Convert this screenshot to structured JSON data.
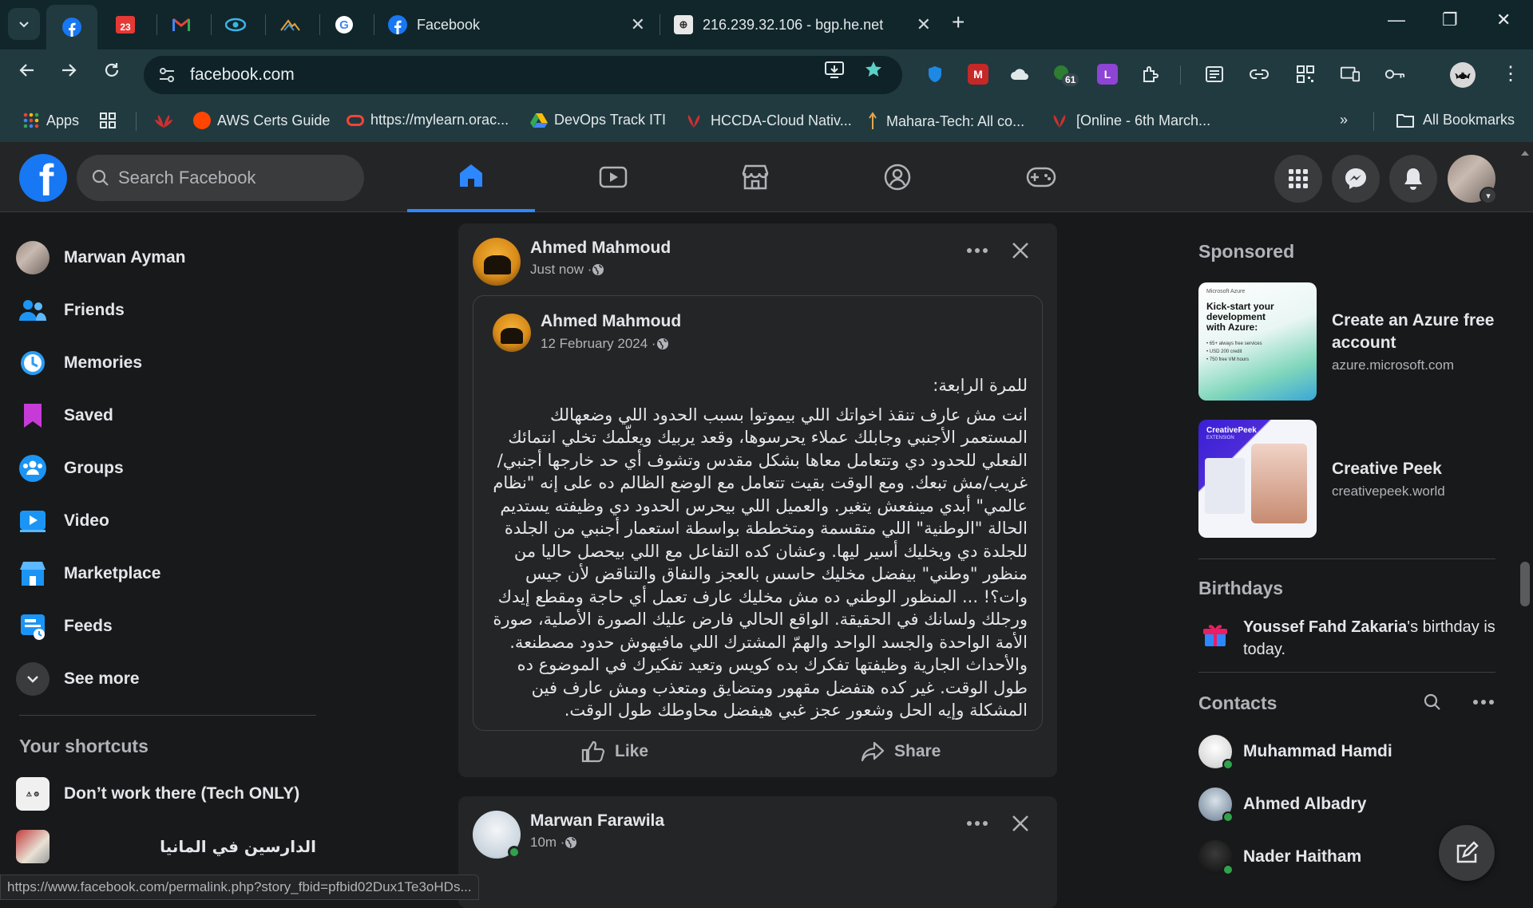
{
  "browser": {
    "tabs": [
      {
        "title": "Facebook"
      },
      {
        "title": "216.239.32.106 - bgp.he.net"
      }
    ],
    "pinned_badge": "23",
    "address_url": "facebook.com",
    "extension_badge": "61",
    "extension_letter": "L",
    "bookmarks": [
      {
        "label": "Apps"
      },
      {
        "label": "AWS Certs Guide"
      },
      {
        "label": "https://mylearn.orac..."
      },
      {
        "label": "DevOps Track ITI"
      },
      {
        "label": "HCCDA-Cloud Nativ..."
      },
      {
        "label": "Mahara-Tech: All co..."
      },
      {
        "label": "[Online - 6th March..."
      }
    ],
    "all_bookmarks": "All Bookmarks",
    "status_url": "https://www.facebook.com/permalink.php?story_fbid=pfbid02Dux1Te3oHDs..."
  },
  "fb": {
    "search_placeholder": "Search Facebook",
    "left_menu": [
      {
        "label": "Marwan Ayman",
        "icon": "profile-avatar"
      },
      {
        "label": "Friends",
        "icon": "friends-icon"
      },
      {
        "label": "Memories",
        "icon": "memories-icon"
      },
      {
        "label": "Saved",
        "icon": "saved-icon"
      },
      {
        "label": "Groups",
        "icon": "groups-icon"
      },
      {
        "label": "Video",
        "icon": "video-icon"
      },
      {
        "label": "Marketplace",
        "icon": "marketplace-icon"
      },
      {
        "label": "Feeds",
        "icon": "feeds-icon"
      },
      {
        "label": "See more",
        "icon": "chevron-down-icon"
      }
    ],
    "shortcuts_title": "Your shortcuts",
    "shortcuts": [
      {
        "label": "Don’t work there (Tech ONLY)"
      },
      {
        "label": "الدارسين في المانيا"
      }
    ],
    "posts": [
      {
        "author": "Ahmed Mahmoud",
        "time": "Just now · ",
        "shared": {
          "author": "Ahmed Mahmoud",
          "date": "12 February 2024 · ",
          "heading": "للمرة الرابعة:",
          "body": "انت مش عارف تنقذ اخواتك اللي بيموتوا بسبب الحدود اللي وضعهالك المستعمر الأجنبي وجابلك عملاء يحرسوها، وقعد يربيك ويعلّمك تخلي انتمائك الفعلي للحدود دي وتتعامل معاها بشكل مقدس وتشوف أي حد خارجها أجنبي/غريب/مش تبعك. ومع الوقت بقيت تتعامل مع الوضع الظالم ده على إنه \"نظام عالمي\" أبدي مينفعش يتغير. والعميل اللي بيحرس الحدود دي وظيفته يستديم الحالة \"الوطنية\" اللي متقسمة ومتخططة بواسطة استعمار أجنبي من الجلدة للجلدة دي ويخليك أسير ليها. وعشان كده التفاعل مع اللي بيحصل حاليا من منظور \"وطني\" بيفضل مخليك حاسس بالعجز والنفاق والتناقض لأن جيس وات؟! ... المنظور الوطني ده مش مخليك عارف تعمل أي حاجة ومقطع إيدك ورجلك ولسانك في الحقيقة. الواقع الحالي فارض عليك الصورة الأصلية، صورة الأمة الواحدة والجسد الواحد والهمّ المشترك اللي مافيهوش حدود مصطنعة. والأحداث الجارية وظيفتها تفكرك بده كويس وتعيد تفكيرك في الموضوع ده طول الوقت. غير كده هتفضل مقهور ومتضايق ومتعذب ومش عارف فين المشكلة وإيه الحل وشعور عجز غبي هيفضل محاوطك طول الوقت."
        },
        "like_label": "Like",
        "share_label": "Share"
      },
      {
        "author": "Marwan Farawila",
        "time": "10m · "
      }
    ],
    "sponsored_title": "Sponsored",
    "ads": [
      {
        "title": "Create an Azure free account",
        "domain": "azure.microsoft.com",
        "img_brand": "Microsoft Azure",
        "img_headline": "Kick-start your development with Azure:",
        "img_bullets": [
          "• 65+ always free services",
          "• USD 200 credit",
          "• 750 free VM hours"
        ]
      },
      {
        "title": "Creative Peek",
        "domain": "creativepeek.world",
        "img_brand": "CreativePeek",
        "img_sub": "EXTENSION"
      }
    ],
    "birthdays_title": "Birthdays",
    "birthday_name": "Youssef Fahd Zakaria",
    "birthday_rest": "'s birthday is today.",
    "contacts_title": "Contacts",
    "contacts": [
      {
        "name": "Muhammad Hamdi"
      },
      {
        "name": "Ahmed Albadry"
      },
      {
        "name": "Nader Haitham"
      }
    ],
    "colors": {
      "accent": "#2d88ff",
      "brand": "#1877f2",
      "online": "#31a24c"
    }
  }
}
